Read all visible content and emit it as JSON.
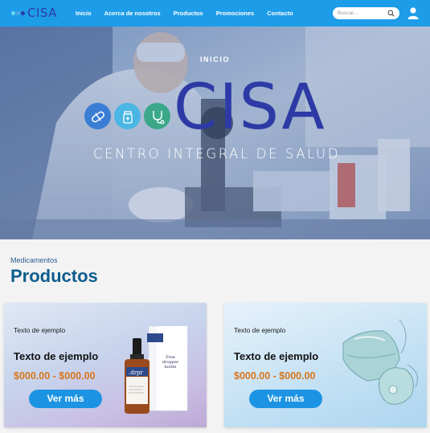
{
  "logo": {
    "text": "CISA",
    "dot_colors": [
      "#6fd5f0",
      "#4fa8e0",
      "#2d3aa6"
    ]
  },
  "nav": {
    "links": [
      "Inicio",
      "Acerca de nosotros",
      "Productos",
      "Promociones",
      "Contacto"
    ]
  },
  "search": {
    "placeholder": "Buscar..."
  },
  "hero": {
    "kicker": "INICIO",
    "title": "CISA",
    "subtitle": "CENTRO INTEGRAL DE SALUD",
    "icon_colors": [
      "#3a7dd4",
      "#4ab6e4",
      "#3aa889"
    ]
  },
  "section": {
    "kicker": "Medicamentos",
    "title": "Productos"
  },
  "cards": [
    {
      "eyebrow": "Texto de ejemplo",
      "title": "Texto de ejemplo",
      "price": "$000.00 - $000.00",
      "button": "Ver más",
      "brand": ".drpr"
    },
    {
      "eyebrow": "Texto de ejemplo",
      "title": "Texto de ejemplo",
      "price": "$000.00 - $000.00",
      "button": "Ver más"
    }
  ],
  "colors": {
    "navbar": "#1d9ce8",
    "accent": "#1c94e3",
    "price": "#d9761a",
    "brand_navy": "#2d3aa6"
  }
}
